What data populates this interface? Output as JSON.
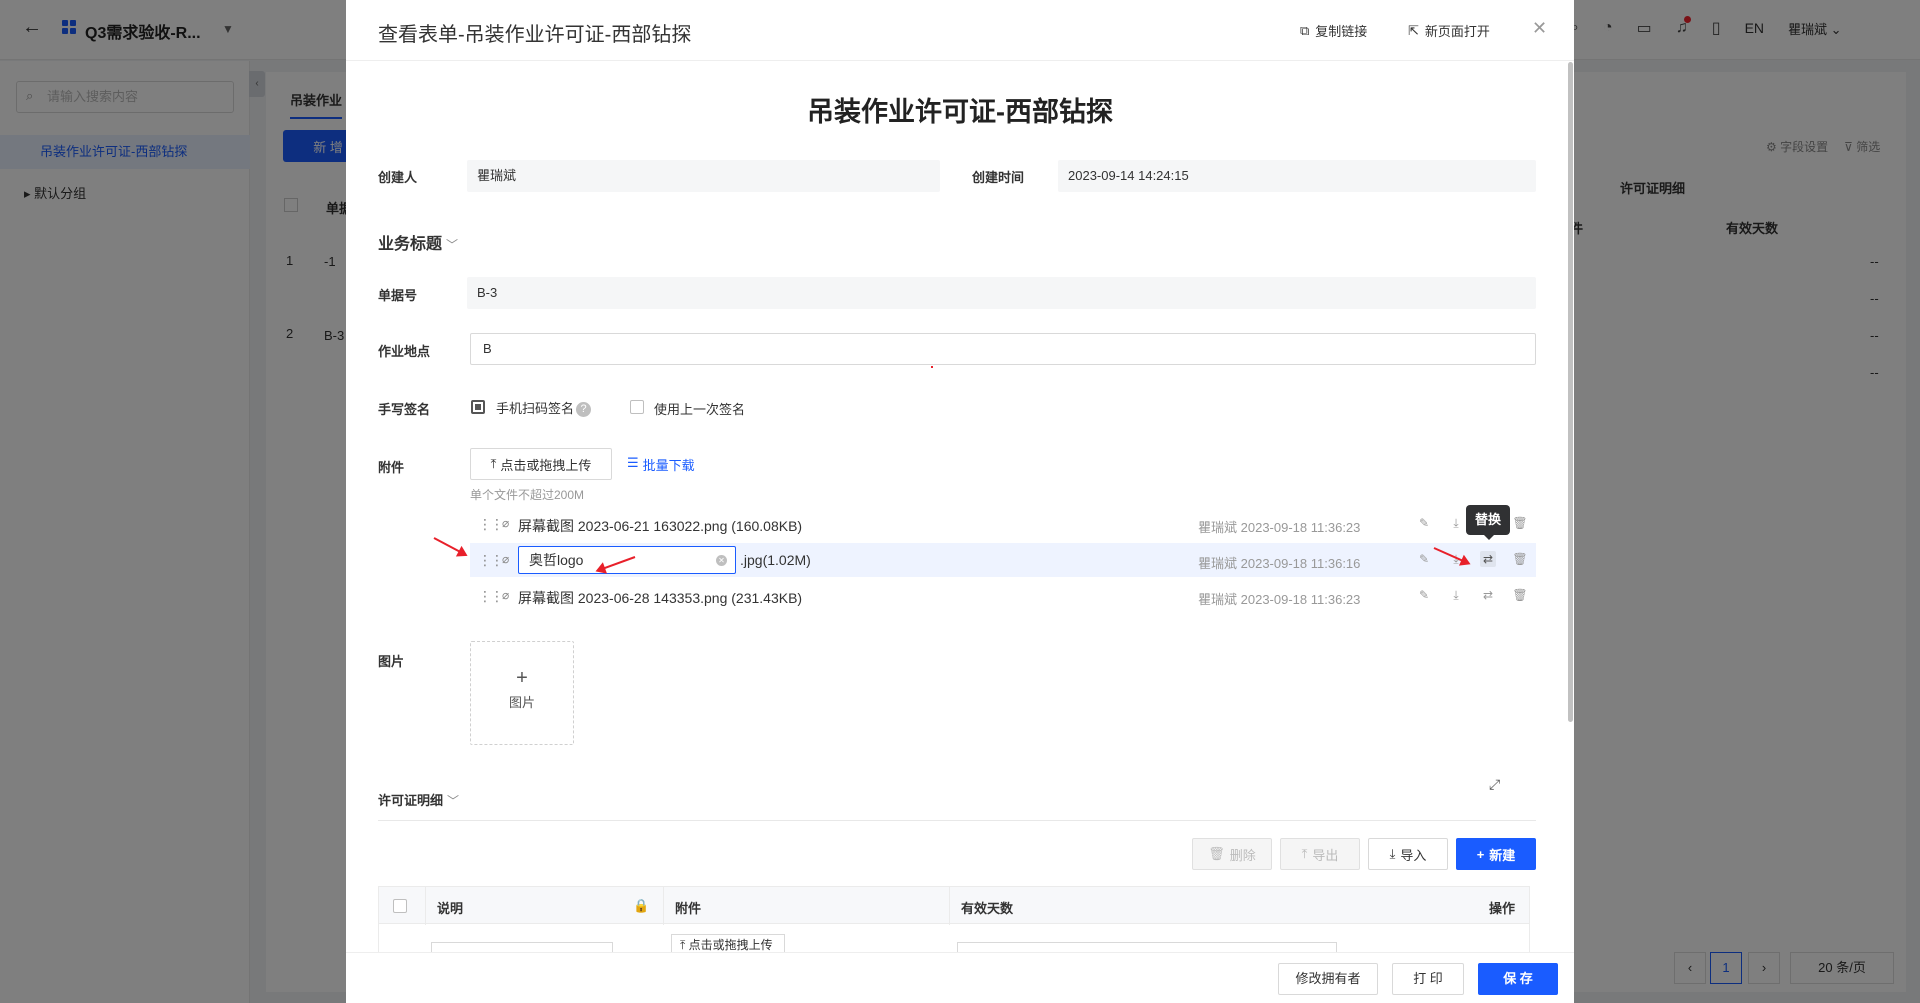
{
  "app": {
    "title": "Q3需求验收-R...",
    "lang": "EN",
    "user": "瞿瑞斌 ⌄",
    "search_placeholder": "请输入搜索内容",
    "nav_active": "吊装作业许可证-西部钻探",
    "nav_group": "默认分组",
    "tab": "吊装作业",
    "add_label": "新 增",
    "field_settings": "字段设置",
    "filter": "筛选",
    "bg_header_group": "许可证明细",
    "bg_col_single": "单据",
    "bg_col_attach": "件",
    "bg_col_days": "有效天数",
    "bg_rows": [
      {
        "idx": "1",
        "code": "-1"
      },
      {
        "idx": "2",
        "code": "B-3"
      }
    ],
    "bg_dash": "--",
    "page_current": "1",
    "page_size": "20 条/页"
  },
  "modal": {
    "title": "查看表单-吊装作业许可证-西部钻探",
    "copy_link": "复制链接",
    "open_new": "新页面打开",
    "form_title": "吊装作业许可证-西部钻探",
    "creator_label": "创建人",
    "creator_value": "瞿瑞斌",
    "created_label": "创建时间",
    "created_value": "2023-09-14 14:24:15",
    "section_business": "业务标题",
    "docno_label": "单据号",
    "docno_value": "B-3",
    "site_label": "作业地点",
    "site_value": "B",
    "sign_label": "手写签名",
    "scan_sign": "手机扫码签名",
    "use_last": "使用上一次签名",
    "attach_label": "附件",
    "upload_btn": "点击或拖拽上传",
    "batch_download": "批量下载",
    "size_hint": "单个文件不超过200M",
    "files": [
      {
        "name": "屏幕截图 2023-06-21 163022.png (160.08KB)",
        "owner": "瞿瑞斌",
        "time": "2023-09-18 11:36:23"
      },
      {
        "rename_value": "奥哲logo",
        "ext": ".jpg(1.02M)",
        "owner": "瞿瑞斌",
        "time": "2023-09-18 11:36:16"
      },
      {
        "name": "屏幕截图 2023-06-28 143353.png (231.43KB)",
        "owner": "瞿瑞斌",
        "time": "2023-09-18 11:36:23"
      }
    ],
    "tooltip_replace": "替换",
    "image_label": "图片",
    "image_upload": "图片",
    "section_detail": "许可证明细",
    "btn_delete": "删除",
    "btn_export": "导出",
    "btn_import": "导入",
    "btn_new": "新建",
    "col_desc": "说明",
    "col_attach": "附件",
    "col_days": "有效天数",
    "col_ops": "操作",
    "row_upload": "点击或拖拽上传",
    "btn_change_owner": "修改拥有者",
    "btn_print": "打 印",
    "btn_save": "保 存"
  }
}
